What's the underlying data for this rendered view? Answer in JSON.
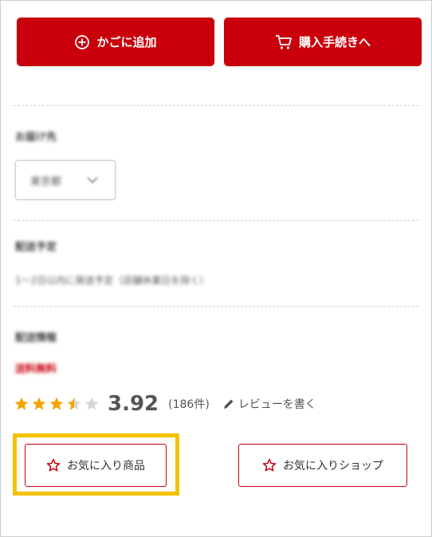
{
  "actions": {
    "add_to_cart_label": "かごに追加",
    "checkout_label": "購入手続きへ"
  },
  "delivery_destination": {
    "label": "お届け先",
    "selected_value": "東京都"
  },
  "delivery_schedule": {
    "label": "配送予定",
    "text": "1〜2日以内に発送予定（店舗休業日を除く）"
  },
  "shipping_fee": {
    "label": "配送情報",
    "value": "送料無料"
  },
  "rating": {
    "stars": 3.5,
    "max_stars": 5,
    "value": "3.92",
    "review_count": "(186件)",
    "write_review_label": "レビューを書く"
  },
  "favorites": {
    "item_label": "お気に入り商品",
    "shop_label": "お気に入りショップ"
  },
  "colors": {
    "brand_red": "#c9000b",
    "star_gold": "#f5a300",
    "highlight_yellow": "#f3c200"
  }
}
